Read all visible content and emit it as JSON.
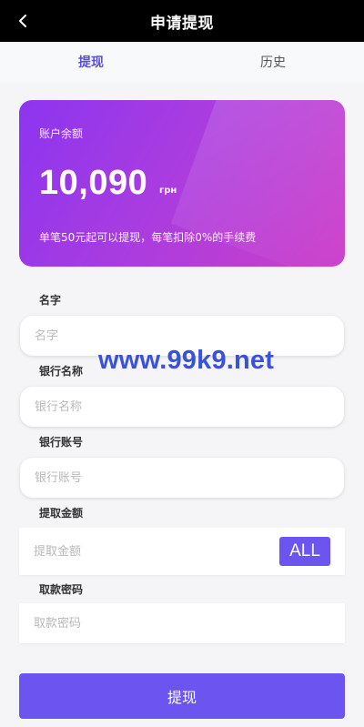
{
  "header": {
    "title": "申请提现",
    "back_icon": "chevron-left-icon"
  },
  "tabs": [
    {
      "label": "提现",
      "active": true
    },
    {
      "label": "历史",
      "active": false
    }
  ],
  "balance_card": {
    "label": "账户余额",
    "amount": "10,090",
    "currency": "грн",
    "note": "单笔50元起可以提现，每笔扣除0%的手续费"
  },
  "form": {
    "name": {
      "label": "名字",
      "placeholder": "名字"
    },
    "bank_name": {
      "label": "银行名称",
      "placeholder": "银行名称"
    },
    "bank_account": {
      "label": "银行账号",
      "placeholder": "银行账号"
    },
    "amount": {
      "label": "提取金额",
      "placeholder": "提取金额",
      "all_label": "ALL"
    },
    "password": {
      "label": "取款密码",
      "placeholder": "取款密码"
    }
  },
  "watermark": "www.99k9.net",
  "submit_label": "提现",
  "colors": {
    "accent": "#6c54f0",
    "card_start": "#8c35f0",
    "card_end": "#cd3fc9",
    "watermark": "#3a52d8"
  }
}
